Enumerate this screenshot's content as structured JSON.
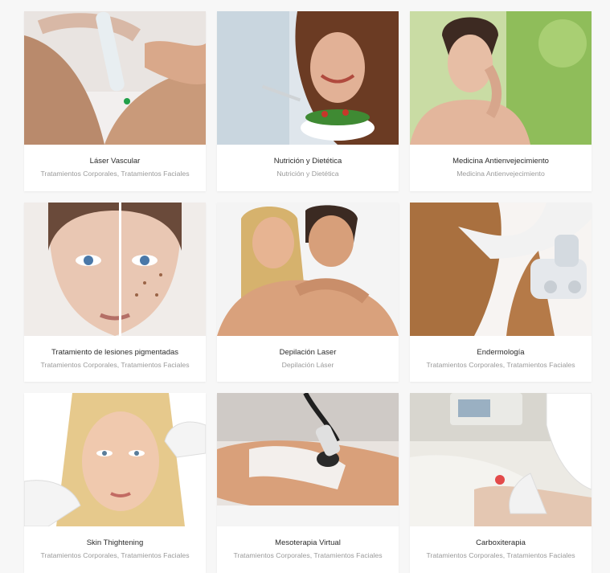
{
  "portfolio": {
    "items": [
      {
        "title": "Láser Vascular",
        "categories": "Tratamientos Corporales, Tratamientos Faciales",
        "image": "laser-vascular-photo"
      },
      {
        "title": "Nutrición y Dietética",
        "categories": "Nutrición y Dietética",
        "image": "nutrition-photo"
      },
      {
        "title": "Medicina Antienvejecimiento",
        "categories": "Medicina Antienvejecimiento",
        "image": "anti-aging-photo"
      },
      {
        "title": "Tratamiento de lesiones pigmentadas",
        "categories": "Tratamientos Corporales, Tratamientos Faciales",
        "image": "pigmented-lesions-photo"
      },
      {
        "title": "Depilación Laser",
        "categories": "Depilación Láser",
        "image": "laser-hair-removal-photo"
      },
      {
        "title": "Endermología",
        "categories": "Tratamientos Corporales, Tratamientos Faciales",
        "image": "endermology-photo"
      },
      {
        "title": "Skin Thightening",
        "categories": "Tratamientos Corporales, Tratamientos Faciales",
        "image": "skin-tightening-photo"
      },
      {
        "title": "Mesoterapia Virtual",
        "categories": "Tratamientos Corporales, Tratamientos Faciales",
        "image": "virtual-mesotherapy-photo"
      },
      {
        "title": "Carboxiterapia",
        "categories": "Tratamientos Corporales, Tratamientos Faciales",
        "image": "carboxytherapy-photo"
      }
    ]
  }
}
